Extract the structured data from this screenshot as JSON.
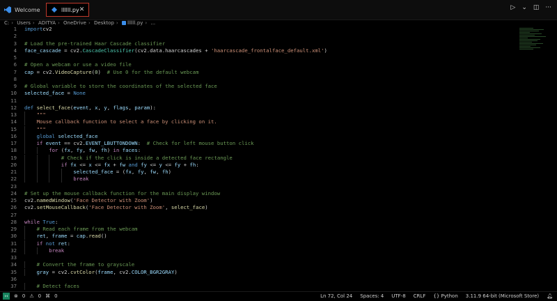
{
  "tabs": [
    {
      "label": "Welcome",
      "active": false
    },
    {
      "label": "llllll.py",
      "active": true
    }
  ],
  "breadcrumb": [
    "C:",
    "Users",
    "ADITYA",
    "OneDrive",
    "Desktop",
    "llllll.py",
    "..."
  ],
  "code_lines": [
    {
      "n": "1",
      "indent": 0,
      "tokens": [
        [
          "kw",
          "import"
        ],
        [
          "",
          "cv2"
        ]
      ]
    },
    {
      "n": "2",
      "indent": 0,
      "tokens": []
    },
    {
      "n": "3",
      "indent": 0,
      "tokens": [
        [
          "cm",
          "# Load the pre-trained Haar Cascade classifier"
        ]
      ]
    },
    {
      "n": "4",
      "indent": 0,
      "tokens": [
        [
          "var",
          "face_cascade"
        ],
        [
          "",
          " = cv2."
        ],
        [
          "cls",
          "CascadeClassifier"
        ],
        [
          "",
          "(cv2.data.haarcascades + "
        ],
        [
          "str",
          "'haarcascade_frontalface_default.xml'"
        ],
        [
          "",
          ")"
        ]
      ]
    },
    {
      "n": "5",
      "indent": 0,
      "tokens": []
    },
    {
      "n": "6",
      "indent": 0,
      "tokens": [
        [
          "cm",
          "# Open a webcam or use a video file"
        ]
      ]
    },
    {
      "n": "7",
      "indent": 0,
      "tokens": [
        [
          "var",
          "cap"
        ],
        [
          "",
          " = cv2."
        ],
        [
          "fn",
          "VideoCapture"
        ],
        [
          "",
          "("
        ],
        [
          "num",
          "0"
        ],
        [
          "",
          ")  "
        ],
        [
          "cm",
          "# Use 0 for the default webcam"
        ]
      ]
    },
    {
      "n": "8",
      "indent": 0,
      "tokens": []
    },
    {
      "n": "9",
      "indent": 0,
      "tokens": [
        [
          "cm",
          "# Global variable to store the coordinates of the selected face"
        ]
      ]
    },
    {
      "n": "10",
      "indent": 0,
      "tokens": [
        [
          "var",
          "selected_face"
        ],
        [
          "",
          " = "
        ],
        [
          "kw",
          "None"
        ]
      ]
    },
    {
      "n": "11",
      "indent": 0,
      "tokens": []
    },
    {
      "n": "12",
      "indent": 0,
      "tokens": [
        [
          "kw",
          "def"
        ],
        [
          "",
          " "
        ],
        [
          "fn",
          "select_face"
        ],
        [
          "",
          "("
        ],
        [
          "var",
          "event"
        ],
        [
          ", "
        ],
        [
          "var",
          "x"
        ],
        [
          ", "
        ],
        [
          "var",
          "y"
        ],
        [
          ", "
        ],
        [
          "var",
          "flags"
        ],
        [
          ", "
        ],
        [
          "var",
          "param"
        ],
        [
          "",
          "):"
        ]
      ]
    },
    {
      "n": "13",
      "indent": 2,
      "tokens": [
        [
          "str",
          "\"\"\""
        ]
      ]
    },
    {
      "n": "14",
      "indent": 2,
      "tokens": [
        [
          "str",
          "Mouse callback function to select a face by clicking on it."
        ]
      ]
    },
    {
      "n": "15",
      "indent": 2,
      "tokens": [
        [
          "str",
          "\"\"\""
        ]
      ]
    },
    {
      "n": "16",
      "indent": 2,
      "tokens": [
        [
          "kw",
          "global"
        ],
        [
          "",
          " "
        ],
        [
          "var",
          "selected_face"
        ]
      ]
    },
    {
      "n": "17",
      "indent": 2,
      "tokens": [
        [
          "ctl",
          "if"
        ],
        [
          "",
          " "
        ],
        [
          "var",
          "event"
        ],
        [
          "",
          " == cv2."
        ],
        [
          "var",
          "EVENT_LBUTTONDOWN"
        ],
        [
          "",
          ":  "
        ],
        [
          "cm",
          "# Check for left mouse button click"
        ]
      ]
    },
    {
      "n": "18",
      "indent": 4,
      "tokens": [
        [
          "ctl",
          "for"
        ],
        [
          "",
          " ("
        ],
        [
          "var",
          "fx"
        ],
        [
          ", "
        ],
        [
          "var",
          "fy"
        ],
        [
          ", "
        ],
        [
          "var",
          "fw"
        ],
        [
          ", "
        ],
        [
          "var",
          "fh"
        ],
        [
          ") "
        ],
        [
          "ctl",
          "in"
        ],
        [
          "",
          " "
        ],
        [
          "var",
          "faces"
        ],
        [
          "",
          ":"
        ]
      ]
    },
    {
      "n": "19",
      "indent": 6,
      "tokens": [
        [
          "cm",
          "# Check if the click is inside a detected face rectangle"
        ]
      ]
    },
    {
      "n": "20",
      "indent": 6,
      "tokens": [
        [
          "ctl",
          "if"
        ],
        [
          "",
          " "
        ],
        [
          "var",
          "fx"
        ],
        [
          "",
          " <= "
        ],
        [
          "var",
          "x"
        ],
        [
          "",
          " <= "
        ],
        [
          "var",
          "fx"
        ],
        [
          "",
          " + "
        ],
        [
          "var",
          "fw"
        ],
        [
          "",
          " "
        ],
        [
          "kw",
          "and"
        ],
        [
          "",
          " "
        ],
        [
          "var",
          "fy"
        ],
        [
          "",
          " <= "
        ],
        [
          "var",
          "y"
        ],
        [
          "",
          " <= "
        ],
        [
          "var",
          "fy"
        ],
        [
          "",
          " + "
        ],
        [
          "var",
          "fh"
        ],
        [
          "",
          ":"
        ]
      ]
    },
    {
      "n": "21",
      "indent": 8,
      "tokens": [
        [
          "var",
          "selected_face"
        ],
        [
          "",
          " = ("
        ],
        [
          "var",
          "fx"
        ],
        [
          ", "
        ],
        [
          "var",
          "fy"
        ],
        [
          ", "
        ],
        [
          "var",
          "fw"
        ],
        [
          ", "
        ],
        [
          "var",
          "fh"
        ],
        [
          ")"
        ]
      ]
    },
    {
      "n": "22",
      "indent": 8,
      "tokens": [
        [
          "ctl",
          "break"
        ]
      ]
    },
    {
      "n": "23",
      "indent": 0,
      "tokens": []
    },
    {
      "n": "24",
      "indent": 0,
      "tokens": [
        [
          "cm",
          "# Set up the mouse callback function for the main display window"
        ]
      ]
    },
    {
      "n": "25",
      "indent": 0,
      "tokens": [
        [
          "",
          "cv2."
        ],
        [
          "fn",
          "namedWindow"
        ],
        [
          "",
          "("
        ],
        [
          "str",
          "'Face Detector with Zoom'"
        ],
        [
          "",
          ")"
        ]
      ]
    },
    {
      "n": "26",
      "indent": 0,
      "tokens": [
        [
          "",
          "cv2."
        ],
        [
          "fn",
          "setMouseCallback"
        ],
        [
          "",
          "("
        ],
        [
          "str",
          "'Face Detector with Zoom'"
        ],
        [
          "",
          ", "
        ],
        [
          "fn",
          "select_face"
        ],
        [
          "",
          ")"
        ]
      ]
    },
    {
      "n": "27",
      "indent": 0,
      "tokens": []
    },
    {
      "n": "28",
      "indent": 0,
      "tokens": [
        [
          "ctl",
          "while"
        ],
        [
          "",
          " "
        ],
        [
          "kw",
          "True"
        ],
        [
          "",
          ":"
        ]
      ]
    },
    {
      "n": "29",
      "indent": 2,
      "tokens": [
        [
          "cm",
          "# Read each frame from the webcam"
        ]
      ]
    },
    {
      "n": "30",
      "indent": 2,
      "tokens": [
        [
          "var",
          "ret"
        ],
        [
          ", "
        ],
        [
          "var",
          "frame"
        ],
        [
          "",
          " = "
        ],
        [
          "var",
          "cap"
        ],
        [
          "",
          "."
        ],
        [
          "fn",
          "read"
        ],
        [
          "",
          "()"
        ]
      ]
    },
    {
      "n": "31",
      "indent": 2,
      "tokens": [
        [
          "ctl",
          "if"
        ],
        [
          "",
          " "
        ],
        [
          "kw",
          "not"
        ],
        [
          "",
          " "
        ],
        [
          "var",
          "ret"
        ],
        [
          "",
          ":"
        ]
      ]
    },
    {
      "n": "32",
      "indent": 4,
      "tokens": [
        [
          "ctl",
          "break"
        ]
      ]
    },
    {
      "n": "33",
      "indent": 0,
      "tokens": []
    },
    {
      "n": "34",
      "indent": 2,
      "tokens": [
        [
          "cm",
          "# Convert the frame to grayscale"
        ]
      ]
    },
    {
      "n": "35",
      "indent": 2,
      "tokens": [
        [
          "var",
          "gray"
        ],
        [
          "",
          " = cv2."
        ],
        [
          "fn",
          "cvtColor"
        ],
        [
          "",
          "("
        ],
        [
          "var",
          "frame"
        ],
        [
          "",
          ", cv2."
        ],
        [
          "var",
          "COLOR_BGR2GRAY"
        ],
        [
          "",
          ")"
        ]
      ]
    },
    {
      "n": "36",
      "indent": 0,
      "tokens": []
    },
    {
      "n": "37",
      "indent": 2,
      "tokens": [
        [
          "cm",
          "# Detect faces"
        ]
      ]
    }
  ],
  "status": {
    "errors": "0",
    "warnings": "0",
    "ports": "0",
    "position": "Ln 72, Col 24",
    "spaces": "Spaces: 4",
    "encoding": "UTF-8",
    "eol": "CRLF",
    "language": "Python",
    "interpreter": "3.11.9 64-bit (Microsoft Store)"
  },
  "colors": {
    "keyword": "#569cd6",
    "control": "#c586c0",
    "function": "#dcdcaa",
    "string": "#ce9178",
    "comment": "#6a9955",
    "variable": "#9cdcfe",
    "active_tab_border": "#c0392b"
  }
}
